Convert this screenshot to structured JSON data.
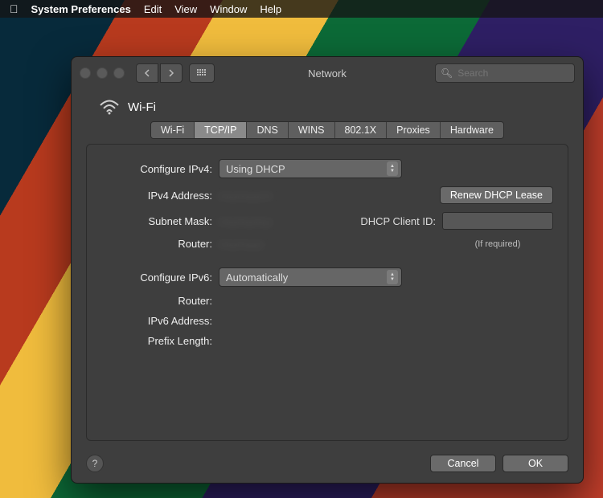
{
  "menubar": {
    "app": "System Preferences",
    "items": [
      "Edit",
      "View",
      "Window",
      "Help"
    ]
  },
  "window": {
    "title": "Network",
    "search_placeholder": "Search"
  },
  "interface": {
    "name": "Wi-Fi"
  },
  "tabs": [
    "Wi-Fi",
    "TCP/IP",
    "DNS",
    "WINS",
    "802.1X",
    "Proxies",
    "Hardware"
  ],
  "active_tab": "TCP/IP",
  "form": {
    "configure_ipv4_label": "Configure IPv4:",
    "configure_ipv4_value": "Using DHCP",
    "ipv4_address_label": "IPv4 Address:",
    "ipv4_address_value": "···.···.·.···",
    "subnet_mask_label": "Subnet Mask:",
    "subnet_mask_value": "···.···.···.·",
    "router_label": "Router:",
    "router_value": "···.···.·.·",
    "renew_button": "Renew DHCP Lease",
    "dhcp_client_id_label": "DHCP Client ID:",
    "dhcp_note": "(If required)",
    "configure_ipv6_label": "Configure IPv6:",
    "configure_ipv6_value": "Automatically",
    "router6_label": "Router:",
    "ipv6_address_label": "IPv6 Address:",
    "prefix_length_label": "Prefix Length:"
  },
  "footer": {
    "cancel": "Cancel",
    "ok": "OK"
  }
}
